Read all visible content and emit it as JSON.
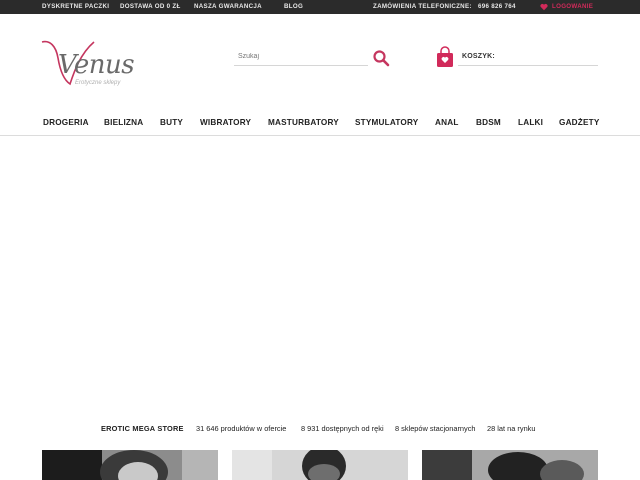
{
  "topbar": {
    "links": [
      "DYSKRETNE PACZKI",
      "DOSTAWA OD 0 ZŁ",
      "NASZA GWARANCJA",
      "BLOG"
    ],
    "phone_label": "ZAMÓWIENIA TELEFONICZNE:",
    "phone_number": "696 826 764",
    "login": "LOGOWANIE",
    "login_icon": "heart-icon"
  },
  "logo": {
    "text": "Venus",
    "tagline": "Erotyczne sklepy"
  },
  "search": {
    "placeholder": "Szukaj",
    "icon": "search-icon"
  },
  "cart": {
    "label": "KOSZYK:",
    "icon": "shopping-bag-icon"
  },
  "nav": {
    "items": [
      "DROGERIA",
      "BIELIZNA",
      "BUTY",
      "WIBRATORY",
      "MASTURBATORY",
      "STYMULATORY",
      "ANAL",
      "BDSM",
      "LALKI",
      "GADŻETY"
    ]
  },
  "stats": {
    "brand": "EROTIC MEGA STORE",
    "items": [
      "31 646 produktów w ofercie",
      "8 931 dostępnych od ręki",
      "8 sklepów stacjonarnych",
      "28 lat na rynku"
    ]
  },
  "colors": {
    "accent": "#d12a5a",
    "topbar_bg": "#2b2b2b"
  }
}
